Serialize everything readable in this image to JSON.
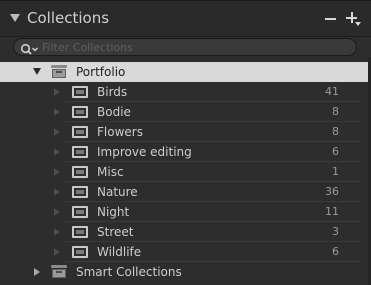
{
  "panel": {
    "title": "Collections",
    "minus_icon": "minus-icon",
    "plus_icon": "plus-dropdown-icon"
  },
  "filter": {
    "placeholder": "Filter Collections",
    "value": "",
    "icon": "search-dropdown-icon"
  },
  "portfolio": {
    "label": "Portfolio",
    "icon": "collection-set-icon",
    "expanded": true
  },
  "collections": [
    {
      "label": "Birds",
      "count": "41"
    },
    {
      "label": "Bodie",
      "count": "8"
    },
    {
      "label": "Flowers",
      "count": "8"
    },
    {
      "label": "Improve editing",
      "count": "6"
    },
    {
      "label": "Misc",
      "count": "1"
    },
    {
      "label": "Nature",
      "count": "36"
    },
    {
      "label": "Night",
      "count": "11"
    },
    {
      "label": "Street",
      "count": "3"
    },
    {
      "label": "Wildlife",
      "count": "6"
    }
  ],
  "smart_collections": {
    "label": "Smart Collections",
    "icon": "collection-set-icon",
    "expanded": false
  },
  "colors": {
    "panel_bg": "#2d2d2d",
    "selected_bg": "#d9d9d9",
    "text": "#cdcdcd",
    "count_text": "#9a9a9a"
  }
}
